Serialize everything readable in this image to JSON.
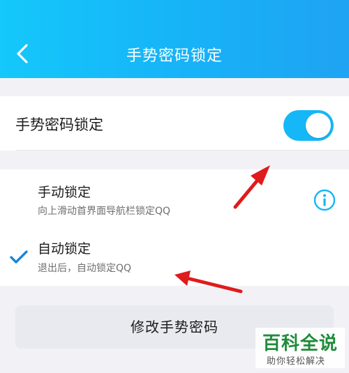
{
  "header": {
    "title": "手势密码锁定"
  },
  "gesture_lock": {
    "label": "手势密码锁定",
    "enabled": true
  },
  "options": [
    {
      "title": "手动锁定",
      "description": "向上滑动首界面导航栏锁定QQ",
      "selected": false,
      "icon": "info-icon"
    },
    {
      "title": "自动锁定",
      "description": "退出后，自动锁定QQ",
      "selected": true,
      "icon": "checkmark-icon"
    }
  ],
  "change_button": {
    "label": "修改手势密码"
  },
  "watermark": {
    "title": "百科全说",
    "subtitle": "助你轻松解决"
  },
  "colors": {
    "accent": "#16b7f6",
    "annotation_arrow": "#e01b1b",
    "watermark": "#1f8c3a"
  }
}
